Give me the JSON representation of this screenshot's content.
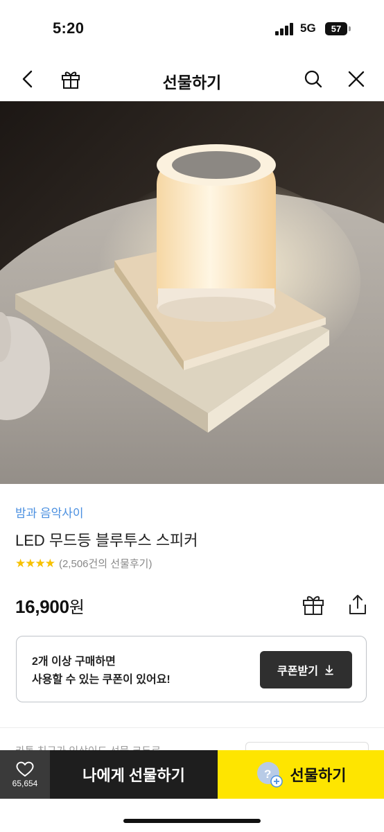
{
  "status_bar": {
    "time": "5:20",
    "network": "5G",
    "battery": "57"
  },
  "nav": {
    "title": "선물하기"
  },
  "product": {
    "brand": "밤과 음악사이",
    "name": "LED 무드등 블루투스 스피커",
    "stars": "★★★★",
    "review_count": "(2,506건의 선물후기)",
    "price": "16,900",
    "price_unit": "원"
  },
  "coupon": {
    "line1": "2개 이상 구매하면",
    "line2": "사용할 수 있는 쿠폰이 있어요!",
    "button_label": "쿠폰받기"
  },
  "partial_section": {
    "text": "카톡 친구가 인상이드 선물 크두로"
  },
  "bottom_bar": {
    "wish_count": "65,654",
    "self_gift_label": "나에게 선물하기",
    "gift_label": "선물하기"
  },
  "colors": {
    "accent_yellow": "#fee500",
    "brand_blue": "#4a8fe0",
    "star": "#f7c100",
    "dark_button": "#2f2f2f"
  }
}
